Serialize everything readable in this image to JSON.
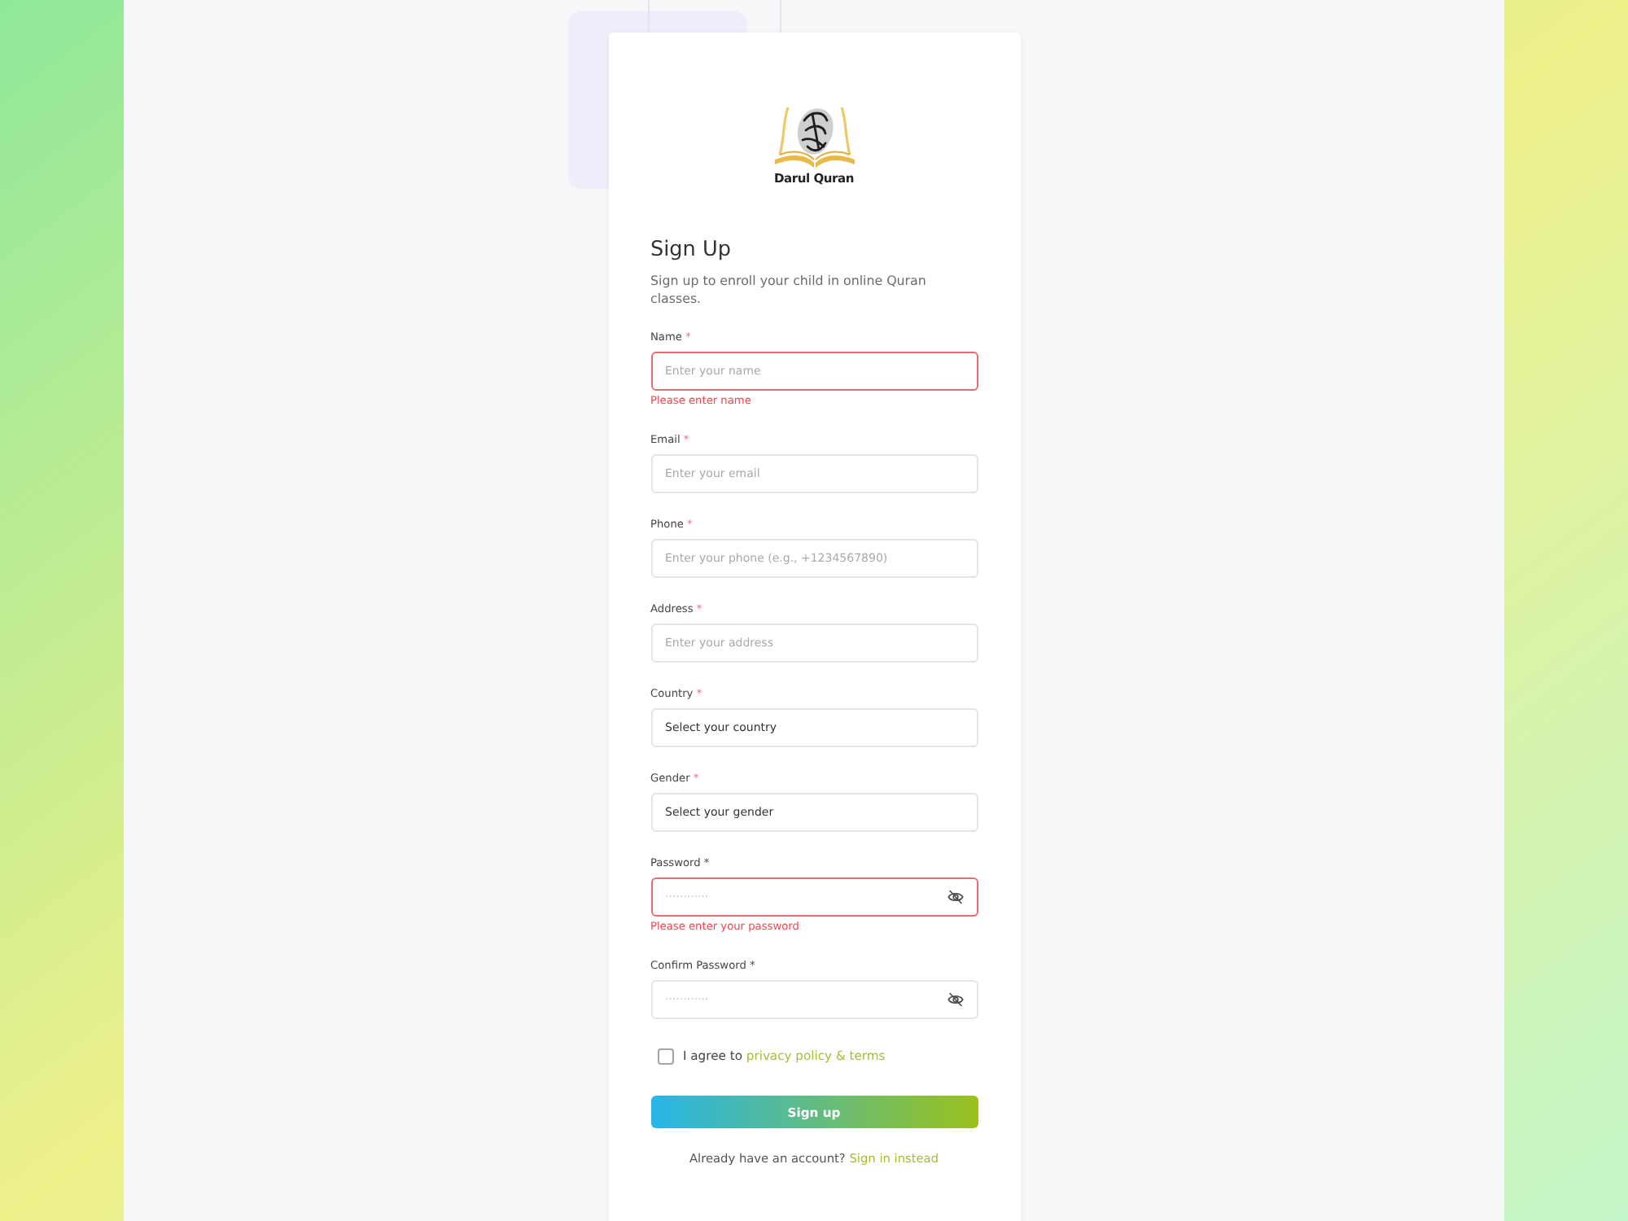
{
  "logo": {
    "text": "Darul Quran"
  },
  "heading": "Sign Up",
  "subtitle": "Sign up to enroll your child in online Quran classes.",
  "fields": [
    {
      "kind": "text",
      "label": "Name",
      "mark": "*",
      "placeholder": "Enter your name",
      "error": "Please enter name"
    },
    {
      "kind": "text",
      "label": "Email",
      "mark": "*",
      "placeholder": "Enter your email"
    },
    {
      "kind": "text",
      "label": "Phone",
      "mark": "*",
      "placeholder": "Enter your phone (e.g., +1234567890)"
    },
    {
      "kind": "text",
      "label": "Address",
      "mark": "*",
      "placeholder": "Enter your address"
    },
    {
      "kind": "select",
      "label": "Country",
      "mark": "*",
      "value": "Select your country"
    },
    {
      "kind": "select",
      "label": "Gender",
      "mark": "*",
      "value": "Select your gender"
    },
    {
      "kind": "password",
      "label": "Password",
      "mark": "*",
      "placeholder": "············",
      "error": "Please enter your password"
    },
    {
      "kind": "password",
      "label": "Confirm Password",
      "mark": "*",
      "placeholder": "············"
    }
  ],
  "agree": {
    "checked": false,
    "text": "I agree to",
    "link": "privacy policy & terms"
  },
  "submit": "Sign up",
  "footer": {
    "text": "Already have an account?",
    "link": "Sign in instead"
  }
}
